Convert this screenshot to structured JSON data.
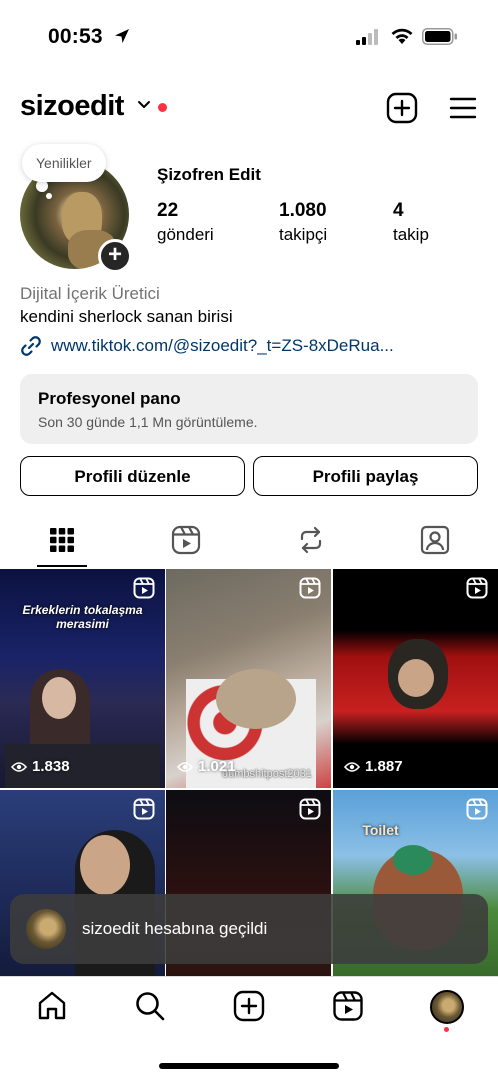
{
  "status_bar": {
    "time": "00:53"
  },
  "header": {
    "username": "sizoedit"
  },
  "note": {
    "text": "Yenilikler"
  },
  "profile": {
    "full_name": "Şizofren Edit",
    "stats": [
      {
        "value": "22",
        "label": "gönderi"
      },
      {
        "value": "1.080",
        "label": "takipçi"
      },
      {
        "value": "4",
        "label": "takip"
      }
    ],
    "category": "Dijital İçerik Üretici",
    "bio": "kendini sherlock sanan birisi",
    "link": "www.tiktok.com/@sizoedit?_t=ZS-8xDeRua..."
  },
  "dashboard": {
    "title": "Profesyonel pano",
    "subtitle": "Son 30 günde 1,1 Mn görüntüleme."
  },
  "buttons": {
    "edit": "Profili düzenle",
    "share": "Profili paylaş"
  },
  "tabs": [
    "posts-grid",
    "reels",
    "reposts",
    "tagged"
  ],
  "grid": [
    {
      "views": "1.838",
      "caption": "Erkeklerin tokalaşma merasimi"
    },
    {
      "views": "1.021",
      "watermark": "dumbshitpost2031"
    },
    {
      "views": "1.887"
    },
    {
      "caption": ""
    },
    {
      "caption": ""
    },
    {
      "caption": "Toilet"
    }
  ],
  "toast": {
    "message": "sizoedit hesabına geçildi"
  },
  "colors": {
    "accent_red": "#ff3040",
    "link_blue": "#00376b",
    "panel_gray": "#efefef"
  }
}
